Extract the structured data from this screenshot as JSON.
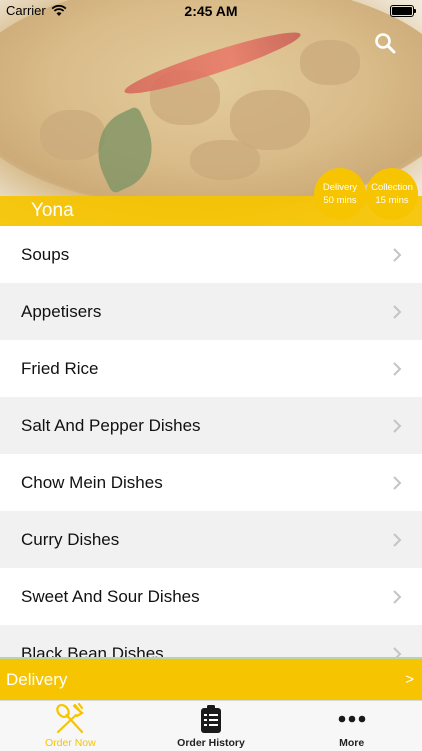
{
  "status_bar": {
    "carrier": "Carrier",
    "time": "2:45 AM"
  },
  "header": {
    "restaurant_name": "Yona",
    "delivery_badge": {
      "label": "Delivery",
      "time": "50 mins"
    },
    "collection_badge": {
      "label": "Collection",
      "time": "15 mins"
    }
  },
  "menu": {
    "categories": [
      "Soups",
      "Appetisers",
      "Fried Rice",
      "Salt And Pepper Dishes",
      "Chow Mein Dishes",
      "Curry Dishes",
      "Sweet And Sour Dishes",
      "Black Bean Dishes"
    ]
  },
  "order_bar": {
    "label": "Delivery",
    "arrow": ">"
  },
  "tabs": [
    {
      "label": "Order Now",
      "icon": "fork-spoon-icon",
      "active": true
    },
    {
      "label": "Order History",
      "icon": "clipboard-list-icon",
      "active": false
    },
    {
      "label": "More",
      "icon": "more-dots-icon",
      "active": false
    }
  ],
  "colors": {
    "accent": "#f6c400",
    "row_alt": "#f1f1f1"
  }
}
